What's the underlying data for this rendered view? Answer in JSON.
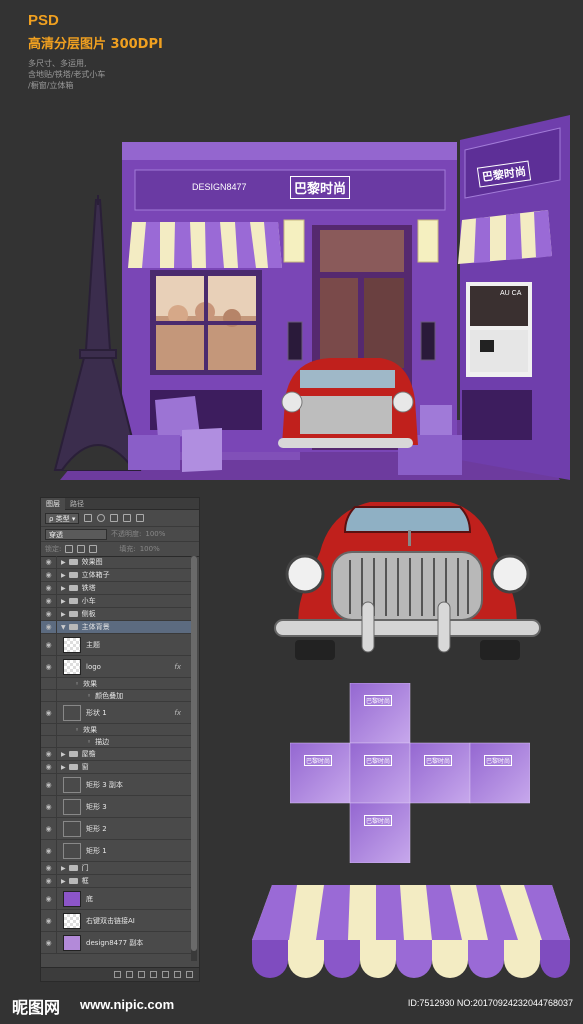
{
  "header": {
    "title": "PSD",
    "subtitle": "高清分层图片 300DPI",
    "notes": [
      "多尺寸、多运用,",
      "含地贴/铁塔/老式小车",
      "/橱窗/立体箱"
    ]
  },
  "store": {
    "logo_text": "DESIGN8477",
    "brand_text": "巴黎时尚",
    "side_brand_text": "巴黎时尚",
    "window_sign": "AU CA"
  },
  "layers_panel": {
    "tabs": [
      "图层",
      "路径"
    ],
    "filter_label": "类型",
    "blend_mode": "穿透",
    "opacity_label": "不透明度:",
    "opacity_value": "100%",
    "lock_label": "锁定:",
    "fill_label": "填充:",
    "fill_value": "100%",
    "layers": [
      {
        "name": "效果图",
        "kind": "folder"
      },
      {
        "name": "立体箱子",
        "kind": "folder"
      },
      {
        "name": "铁塔",
        "kind": "folder"
      },
      {
        "name": "小车",
        "kind": "folder"
      },
      {
        "name": "侧板",
        "kind": "folder"
      },
      {
        "name": "主体背景",
        "kind": "folder-open"
      },
      {
        "name": "主题",
        "kind": "layer"
      },
      {
        "name": "logo",
        "kind": "layer",
        "fx": "fx"
      },
      {
        "name": "效果",
        "kind": "sub"
      },
      {
        "name": "颜色叠加",
        "kind": "sub2"
      },
      {
        "name": "形状 1",
        "kind": "shape",
        "fx": "fx"
      },
      {
        "name": "效果",
        "kind": "sub"
      },
      {
        "name": "描边",
        "kind": "sub2"
      },
      {
        "name": "屋檐",
        "kind": "folder"
      },
      {
        "name": "窗",
        "kind": "folder"
      },
      {
        "name": "矩形 3 副本",
        "kind": "shape"
      },
      {
        "name": "矩形 3",
        "kind": "shape"
      },
      {
        "name": "矩形 2",
        "kind": "shape"
      },
      {
        "name": "矩形 1",
        "kind": "shape"
      },
      {
        "name": "门",
        "kind": "folder"
      },
      {
        "name": "框",
        "kind": "folder"
      },
      {
        "name": "底",
        "kind": "fill"
      },
      {
        "name": "右键双击链接AI",
        "kind": "layer"
      },
      {
        "name": "design8477 副本",
        "kind": "light"
      }
    ]
  },
  "box_net": {
    "label": "巴黎时尚"
  },
  "colors": {
    "accent": "#f0a020",
    "purple": "#8a55c6",
    "purple_dark": "#6b3aa6",
    "cream": "#f3ecc3",
    "car_red": "#c0201c"
  },
  "footer": {
    "logo": "昵图网",
    "url": "www.nipic.com",
    "id": "ID:7512930 NO:20170924232044768037"
  }
}
